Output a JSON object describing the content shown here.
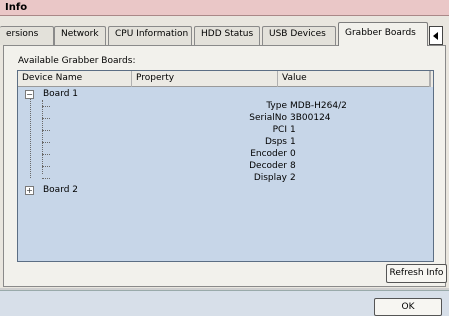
{
  "window": {
    "title": "Info"
  },
  "tabs": [
    {
      "label": "ersions"
    },
    {
      "label": "Network"
    },
    {
      "label": "CPU Information"
    },
    {
      "label": "HDD Status"
    },
    {
      "label": "USB Devices"
    },
    {
      "label": "Grabber Boards",
      "active": true
    }
  ],
  "panel": {
    "label": "Available Grabber Boards:",
    "columns": [
      "Device Name",
      "Property",
      "Value"
    ],
    "boards": [
      {
        "name": "Board 1",
        "expanded": true,
        "properties": [
          {
            "property": "Type",
            "value": "MDB-H264/2"
          },
          {
            "property": "SerialNo",
            "value": "3B00124"
          },
          {
            "property": "PCI",
            "value": "1"
          },
          {
            "property": "Dsps",
            "value": "1"
          },
          {
            "property": "Encoder",
            "value": "0"
          },
          {
            "property": "Decoder",
            "value": "8"
          },
          {
            "property": "Display",
            "value": "2"
          }
        ]
      },
      {
        "name": "Board 2",
        "expanded": false,
        "properties": []
      }
    ],
    "refresh_label": "Refresh Info"
  },
  "footer": {
    "ok_label": "OK"
  },
  "colors": {
    "titlebar": "#eac7c7",
    "listview_bg": "#c7d6e8",
    "footer_bg": "#d7dfe9"
  }
}
